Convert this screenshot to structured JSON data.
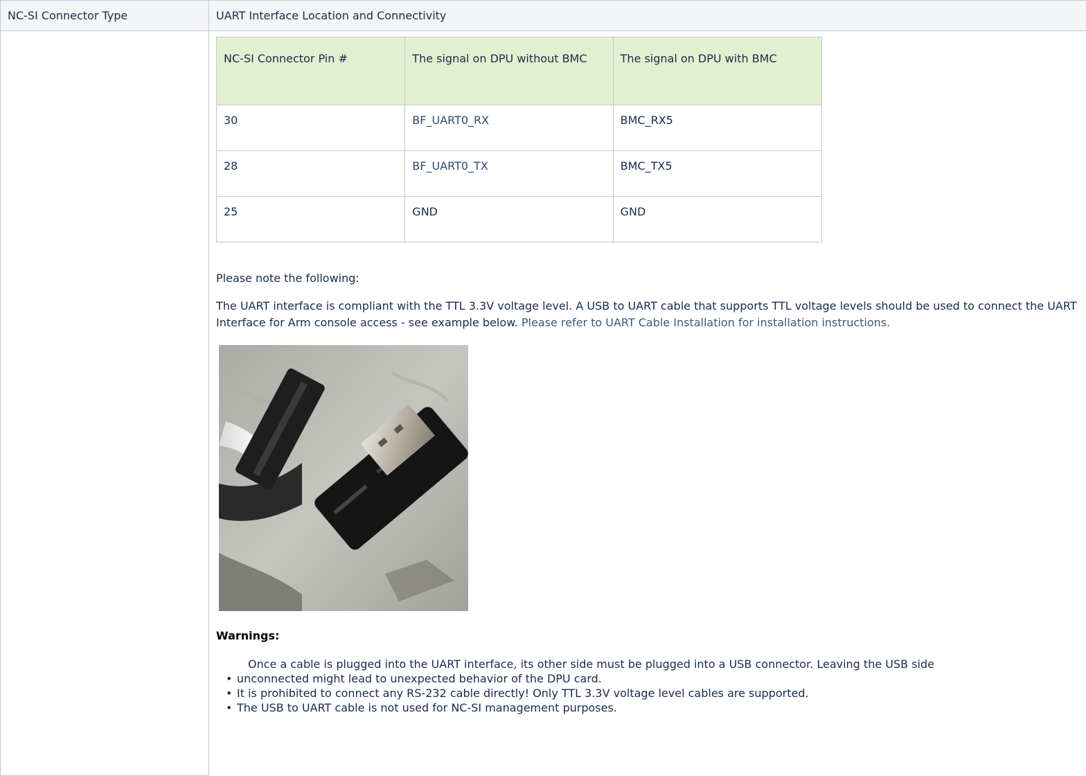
{
  "header": {
    "col1": "NC-SI Connector Type",
    "col2": "UART Interface Location and Connectivity"
  },
  "pin_table": {
    "headers": [
      "NC-SI Connector Pin #",
      "The signal on DPU without BMC",
      "The signal on DPU with BMC"
    ],
    "rows": [
      [
        "30",
        "BF_UART0_RX",
        "BMC_RX5"
      ],
      [
        "28",
        "BF_UART0_TX",
        "BMC_TX5"
      ],
      [
        "25",
        "GND",
        "GND"
      ]
    ]
  },
  "note_heading": "Please note the following:",
  "paragraph": {
    "text": "The UART interface is compliant with the TTL 3.3V voltage level. A USB to UART cable that supports TTL voltage levels should be used to connect the UART Interface for Arm console access - see example below. ",
    "link_text": "Please refer to UART Cable Installation for installation instructions."
  },
  "warnings": {
    "heading": "Warnings:",
    "items": [
      "Once a cable is plugged into the UART interface, its other side must be plugged into a USB connector. Leaving the USB side",
      "unconnected might lead to unexpected behavior of the DPU card.",
      "It is prohibited to connect any RS-232 cable directly! Only TTL 3.3V voltage level cables are supported.",
      "The USB to UART cable is not used for NC-SI management purposes."
    ]
  }
}
